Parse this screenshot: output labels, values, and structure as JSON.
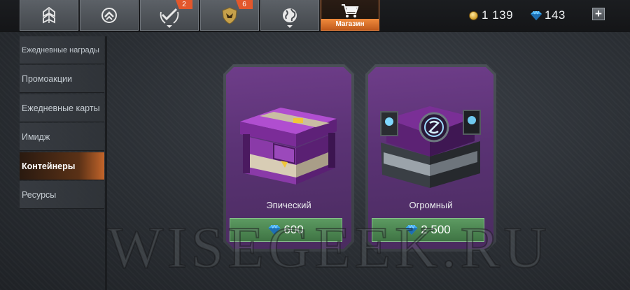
{
  "topbar": {
    "tabs": [
      {
        "icon": "rank-insignia-icon",
        "badge": ""
      },
      {
        "icon": "upgrade-arrow-icon",
        "badge": ""
      },
      {
        "icon": "missions-check-icon",
        "badge": "2"
      },
      {
        "icon": "clan-emblem-icon",
        "badge": "6"
      },
      {
        "icon": "globe-icon",
        "badge": ""
      },
      {
        "icon": "shopping-cart-icon",
        "label": "Магазин"
      }
    ],
    "gold": "1 139",
    "gems": "143",
    "add_label": "+"
  },
  "sidebar": {
    "items": [
      {
        "label": "Ежедневные награды"
      },
      {
        "label": "Промоакции"
      },
      {
        "label": "Ежедневные карты"
      },
      {
        "label": "Имидж"
      },
      {
        "label": "Контейнеры",
        "active": true
      },
      {
        "label": "Ресурсы"
      }
    ]
  },
  "containers": [
    {
      "name": "Эпический",
      "price": "600",
      "currency": "gem-icon"
    },
    {
      "name": "Огромный",
      "price": "2 500",
      "currency": "gem-icon"
    }
  ],
  "watermark": "WISEGEEK.RU",
  "colors": {
    "accent": "#e07c3a",
    "buy_button": "#4f8754",
    "card_purple": "#5a3274",
    "gem_blue": "#38a8f0"
  }
}
